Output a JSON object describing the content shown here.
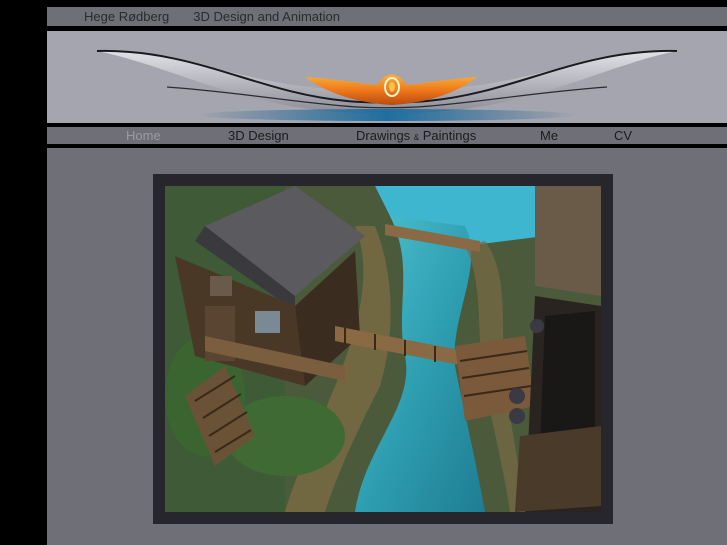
{
  "header": {
    "name": "Hege Rødberg",
    "tagline": "3D Design and Animation"
  },
  "nav": {
    "items": [
      {
        "label": "Home",
        "active": true
      },
      {
        "label": "3D Design",
        "active": false
      },
      {
        "label_main": "Drawings ",
        "label_amp": "&",
        "label_end": " Paintings",
        "active": false
      },
      {
        "label": "Me",
        "active": false
      },
      {
        "label": "CV",
        "active": false
      }
    ]
  },
  "colors": {
    "background": "#000000",
    "bar": "#6f6f78",
    "banner": "#a5a5af",
    "accent_orange": "#f07a1c",
    "frame": "#26262c",
    "water": "#38b6c4"
  },
  "icons": {
    "banner_logo": "swirl-wave-logo-icon"
  }
}
